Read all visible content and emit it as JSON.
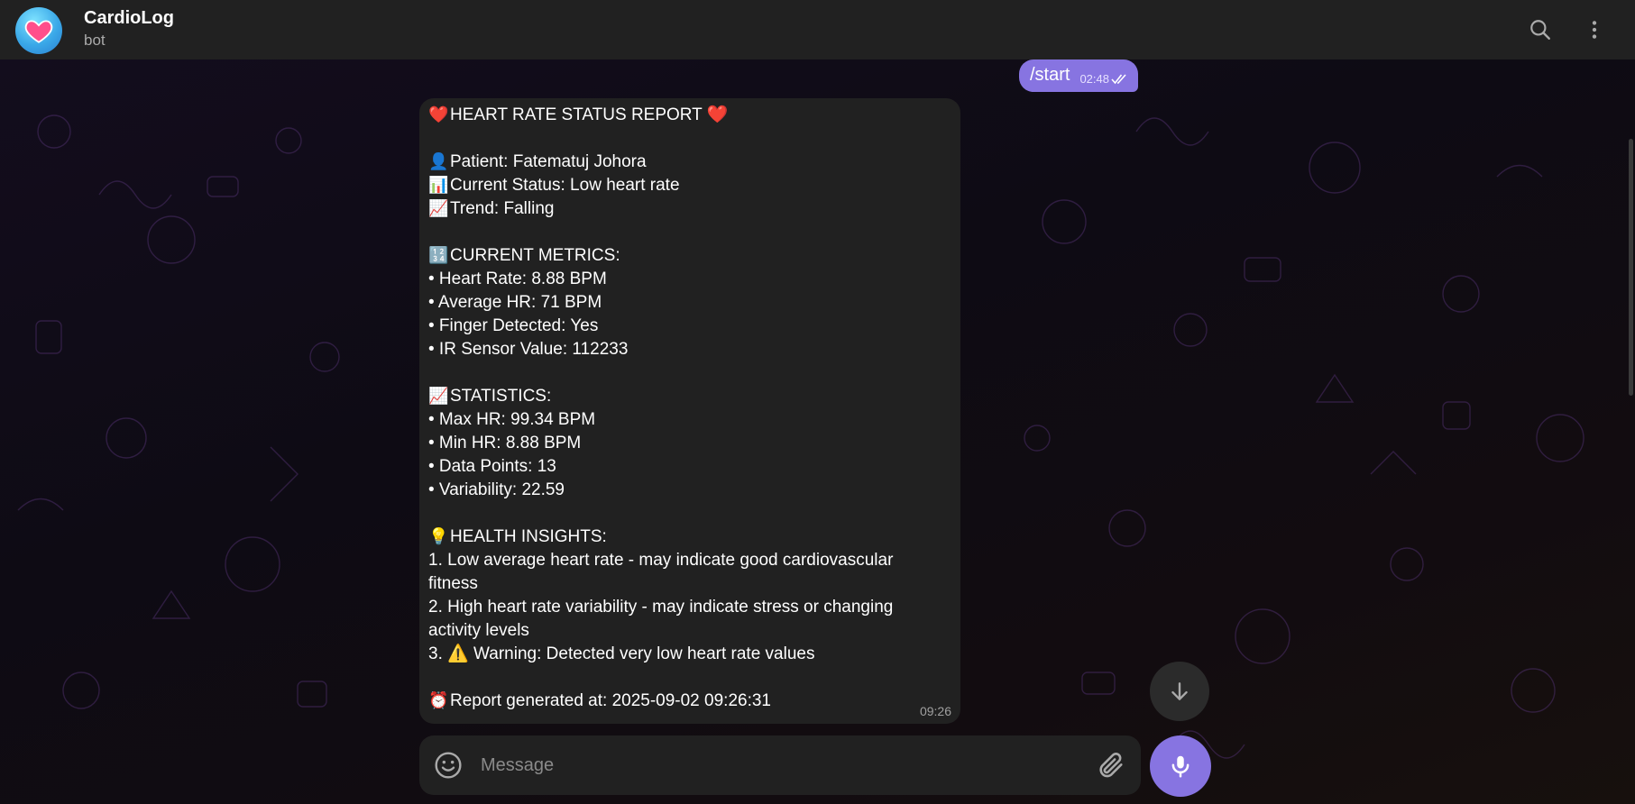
{
  "header": {
    "title": "CardioLog",
    "subtitle": "bot"
  },
  "outgoing": {
    "text": "/start",
    "time": "02:48"
  },
  "report": {
    "time": "09:26",
    "lines": [
      {
        "icon": "❤️",
        "text": "HEART RATE STATUS REPORT ❤️"
      },
      {
        "gap": true
      },
      {
        "icon": "👤",
        "text": "Patient: Fatematuj Johora"
      },
      {
        "icon": "📊",
        "text": "Current Status: Low heart rate"
      },
      {
        "icon": "📈",
        "text": "Trend: Falling"
      },
      {
        "gap": true
      },
      {
        "icon": "🔢",
        "text": "CURRENT METRICS:"
      },
      {
        "text": "• Heart Rate: 8.88 BPM"
      },
      {
        "text": "• Average HR: 71 BPM"
      },
      {
        "text": "• Finger Detected: Yes"
      },
      {
        "text": "• IR Sensor Value: 112233"
      },
      {
        "gap": true
      },
      {
        "icon": "📈",
        "text": "STATISTICS:"
      },
      {
        "text": "• Max HR: 99.34 BPM"
      },
      {
        "text": "• Min HR: 8.88 BPM"
      },
      {
        "text": "• Data Points: 13"
      },
      {
        "text": "• Variability: 22.59"
      },
      {
        "gap": true
      },
      {
        "icon": "💡",
        "text": "HEALTH INSIGHTS:"
      },
      {
        "text": "1. Low average heart rate - may indicate good cardiovascular"
      },
      {
        "text": "fitness"
      },
      {
        "text": "2. High heart rate variability - may indicate stress or changing"
      },
      {
        "text": "activity levels"
      },
      {
        "text": "3. ⚠️ Warning: Detected very low heart rate values"
      },
      {
        "gap": true
      },
      {
        "icon": "⏰",
        "text": "Report generated at: 2025-09-02 09:26:31"
      }
    ]
  },
  "composer": {
    "placeholder": "Message"
  },
  "icons": {
    "avatar": "heart-icon",
    "search": "search-icon",
    "more": "more-vertical-icon",
    "scroll_down": "arrow-down-icon",
    "emoji": "smiley-icon",
    "attach": "paperclip-icon",
    "mic": "microphone-icon",
    "read_status": "double-check-icon"
  },
  "colors": {
    "accent": "#8774e1",
    "bubble": "#212121",
    "header": "#212121"
  }
}
